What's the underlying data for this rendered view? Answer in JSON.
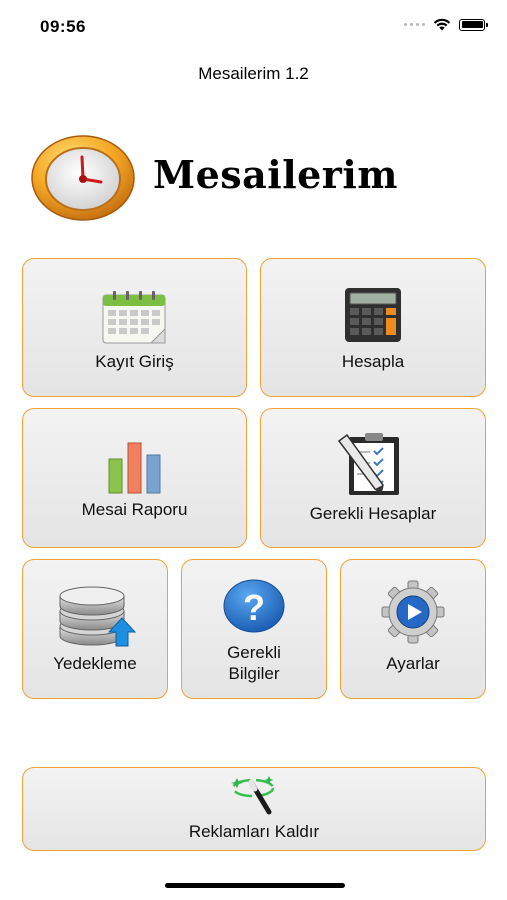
{
  "status": {
    "time": "09:56"
  },
  "nav": {
    "title": "Mesailerim 1.2"
  },
  "logo": {
    "text": "Mesailerim"
  },
  "menu": {
    "kayit_giris": "Kayıt Giriş",
    "hesapla": "Hesapla",
    "mesai_raporu": "Mesai Raporu",
    "gerekli_hesaplar": "Gerekli Hesaplar",
    "yedekleme": "Yedekleme",
    "gerekli_bilgiler_line1": "Gerekli",
    "gerekli_bilgiler_line2": "Bilgiler",
    "ayarlar": "Ayarlar",
    "reklamlari_kaldir": "Reklamları Kaldır"
  },
  "icons": {
    "clock": "clock-icon",
    "calendar": "calendar-icon",
    "calculator": "calculator-icon",
    "bar_chart": "bar-chart-icon",
    "checklist": "checklist-icon",
    "database_backup": "database-upload-icon",
    "help": "question-icon",
    "settings": "gear-play-icon",
    "magic_wand": "magic-wand-icon"
  },
  "colors": {
    "tile_border": "#f0a235",
    "tile_bg": "#ececec",
    "help_blue": "#2d7fd6"
  }
}
